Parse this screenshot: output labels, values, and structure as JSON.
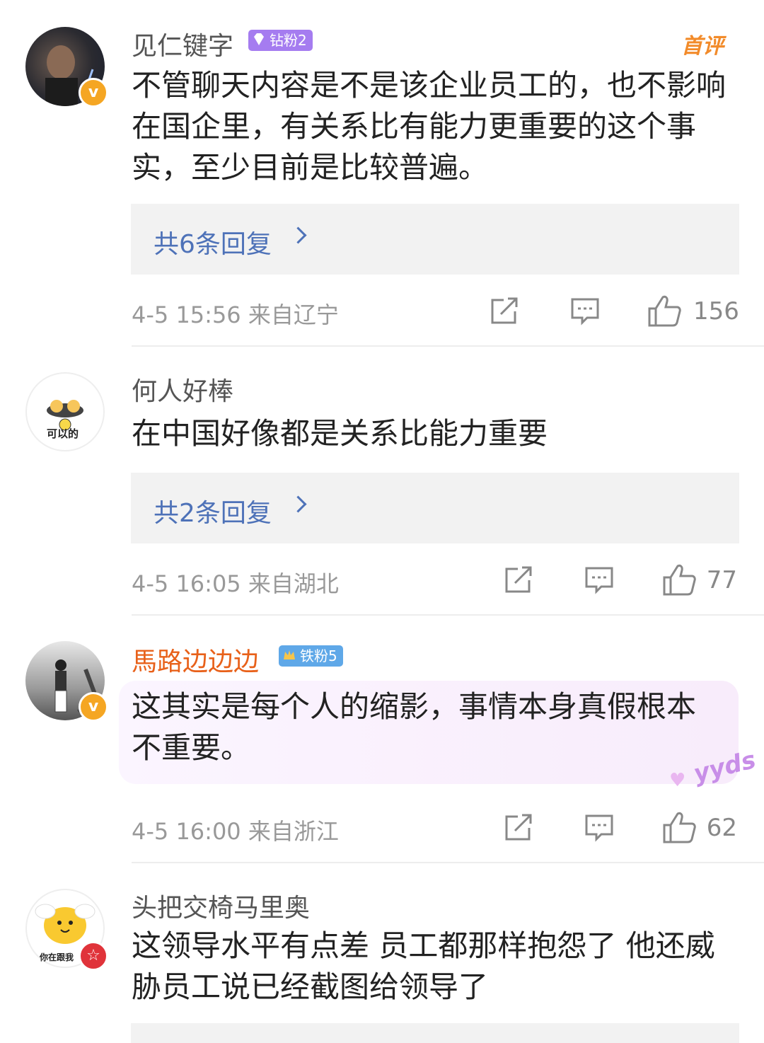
{
  "comments": [
    {
      "username": "见仁键字",
      "badge": "钻粉2",
      "badge_color": "#a57cf0",
      "tag": "首评",
      "text": "不管聊天内容是不是该企业员工的，也不影响在国企里，有关系比有能力更重要的这个事实，至少目前是比较普遍。",
      "replies": "共6条回复",
      "meta": "4-5 15:56  来自辽宁",
      "likes": "156"
    },
    {
      "username": "何人好棒",
      "avatar_caption": "可以的",
      "text": "在中国好像都是关系比能力重要",
      "replies": "共2条回复",
      "meta": "4-5 16:05  来自湖北",
      "likes": "77"
    },
    {
      "username": "馬路边边边",
      "badge": "铁粉5",
      "badge_color": "#5fa8e8",
      "text": "这其实是每个人的缩影，事情本身真假根本不重要。",
      "sticker": "yyds",
      "meta": "4-5 16:00  来自浙江",
      "likes": "62"
    },
    {
      "username": "头把交椅马里奥",
      "avatar_caption": "你在跟我",
      "text": "这领导水平有点差 员工都那样抱怨了 他还威胁员工说已经截图给领导了"
    }
  ],
  "icons": [
    "share-icon",
    "comment-icon",
    "like-icon",
    "verified-icon",
    "gem-icon",
    "crown-icon"
  ],
  "colors": {
    "link": "#4e72b8",
    "orange_name": "#e8611a",
    "first_tag": "#f28b2a",
    "verified": "#f5a623"
  }
}
